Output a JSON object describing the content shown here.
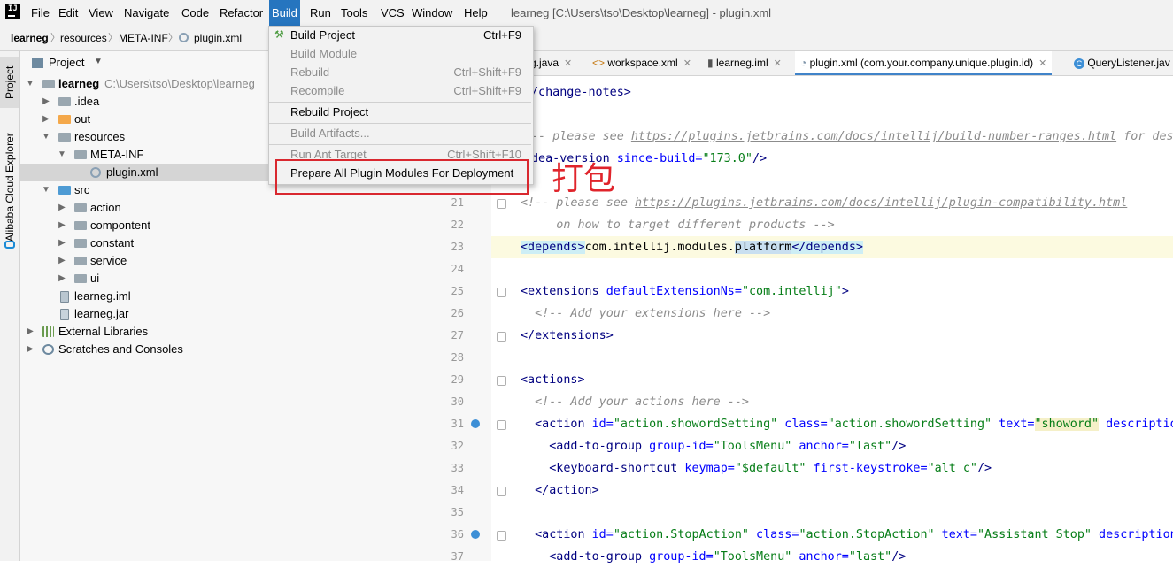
{
  "app": {
    "window_title": "learneg [C:\\Users\\tso\\Desktop\\learneg] - plugin.xml",
    "menu": [
      "File",
      "Edit",
      "View",
      "Navigate",
      "Code",
      "Refactor",
      "Build",
      "Run",
      "Tools",
      "VCS",
      "Window",
      "Help"
    ],
    "active_menu": "Build"
  },
  "breadcrumb": [
    "learneg",
    "resources",
    "META-INF",
    "plugin.xml"
  ],
  "side_stripe": {
    "project_tab": "Project",
    "alibaba_tab": "Alibaba Cloud Explorer"
  },
  "project_panel": {
    "title": "Project",
    "tree": [
      {
        "label": "learneg",
        "path": "C:\\Users\\tso\\Desktop\\learneg"
      },
      {
        "label": ".idea"
      },
      {
        "label": "out"
      },
      {
        "label": "resources"
      },
      {
        "label": "META-INF"
      },
      {
        "label": "plugin.xml"
      },
      {
        "label": "src"
      },
      {
        "label": "action"
      },
      {
        "label": "compontent"
      },
      {
        "label": "constant"
      },
      {
        "label": "service"
      },
      {
        "label": "ui"
      },
      {
        "label": "learneg.iml"
      },
      {
        "label": "learneg.jar"
      },
      {
        "label": "External Libraries"
      },
      {
        "label": "Scratches and Consoles"
      }
    ]
  },
  "editor_tabs": [
    {
      "label": "g.java"
    },
    {
      "label": "workspace.xml"
    },
    {
      "label": "learneg.iml"
    },
    {
      "label": "plugin.xml (com.your.company.unique.plugin.id)"
    },
    {
      "label": "QueryListener.jav"
    }
  ],
  "build_menu": {
    "items": [
      {
        "label": "Build Project",
        "shortcut": "Ctrl+F9"
      },
      {
        "label": "Build Module",
        "shortcut": ""
      },
      {
        "label": "Rebuild",
        "shortcut": "Ctrl+Shift+F9"
      },
      {
        "label": "Recompile",
        "shortcut": "Ctrl+Shift+F9"
      },
      {
        "label": "Rebuild Project",
        "shortcut": ""
      },
      {
        "label": "Build Artifacts...",
        "shortcut": ""
      },
      {
        "label": "Run Ant Target",
        "shortcut": "Ctrl+Shift+F10"
      },
      {
        "label": "Prepare All Plugin Modules For Deployment",
        "shortcut": ""
      }
    ]
  },
  "annotation": "打包",
  "line_numbers": [
    "21",
    "22",
    "23",
    "24",
    "25",
    "26",
    "27",
    "28",
    "29",
    "30",
    "31",
    "32",
    "33",
    "34",
    "35",
    "36",
    "37"
  ],
  "code": {
    "l0_a": "/change-notes>",
    "l2_a": "-- please see ",
    "l2_link": "https://plugins.jetbrains.com/docs/intellij/build-number-ranges.html",
    "l2_b": " for des",
    "l3_tag": "dea-version",
    "l3_attr": " since-build=",
    "l3_val": "\"173.0\"",
    "l3_end": "/>",
    "l5_a": "<!-- please see ",
    "l5_link": "https://plugins.jetbrains.com/docs/intellij/plugin-compatibility.html",
    "l6": "     on how to target different products -->",
    "l7_open": "<depends>",
    "l7_text": "com.intellij.modules.",
    "l7_hl": "platform",
    "l7_close": "</depends>",
    "l9_open": "<extensions",
    "l9_attr": " defaultExtensionNs=",
    "l9_val": "\"com.intellij\"",
    "l9_end": ">",
    "l10": "  <!-- Add your extensions here -->",
    "l11": "</extensions>",
    "l13": "<actions>",
    "l14": "  <!-- Add your actions here -->",
    "l15_tag": "  <action",
    "l15_a1": " id=",
    "l15_v1": "\"action.showordSetting\"",
    "l15_a2": " class=",
    "l15_v2": "\"action.showordSetting\"",
    "l15_a3": " text=",
    "l15_v3": "\"showord\"",
    "l15_a4": " descriptio",
    "l16_tag": "    <add-to-group",
    "l16_a1": " group-id=",
    "l16_v1": "\"ToolsMenu\"",
    "l16_a2": " anchor=",
    "l16_v2": "\"last\"",
    "l16_end": "/>",
    "l17_tag": "    <keyboard-shortcut",
    "l17_a1": " keymap=",
    "l17_v1": "\"$default\"",
    "l17_a2": " first-keystroke=",
    "l17_v2": "\"alt c\"",
    "l17_end": "/>",
    "l18": "  </action>",
    "l20_tag": "  <action",
    "l20_a1": " id=",
    "l20_v1": "\"action.StopAction\"",
    "l20_a2": " class=",
    "l20_v2": "\"action.StopAction\"",
    "l20_a3": " text=",
    "l20_v3": "\"Assistant Stop\"",
    "l20_a4": " description",
    "l21_tag": "    <add-to-group",
    "l21_a1": " group-id=",
    "l21_v1": "\"ToolsMenu\"",
    "l21_a2": " anchor=",
    "l21_v2": "\"last\"",
    "l21_end": "/>"
  },
  "colors": {
    "accent": "#2675bf",
    "annotation_red": "#e0242b",
    "selection": "#d5d5d5"
  }
}
